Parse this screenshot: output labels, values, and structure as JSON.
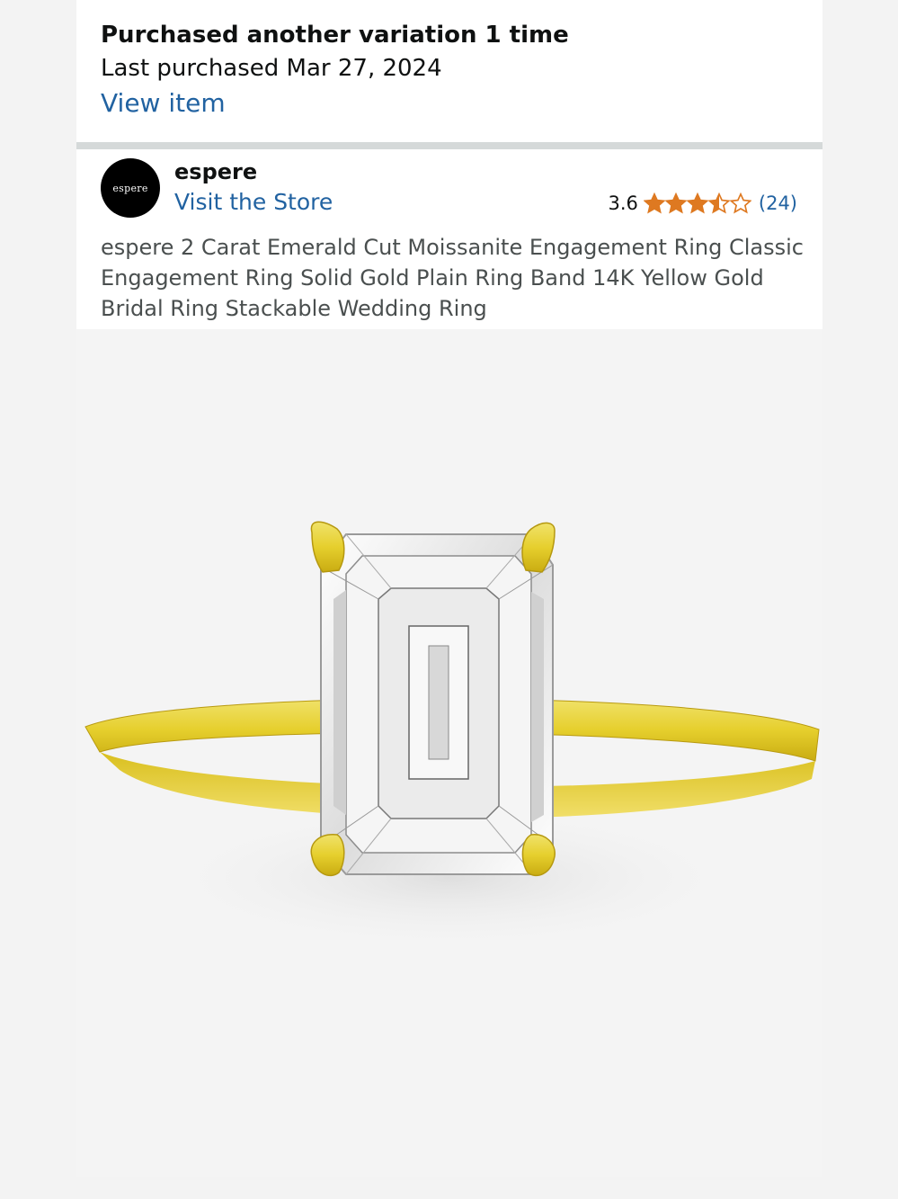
{
  "purchase_banner": {
    "title": "Purchased another variation 1 time",
    "last_purchased": "Last purchased Mar 27, 2024",
    "view_item_label": "View item"
  },
  "store": {
    "logo_text": "espere",
    "name": "espere",
    "visit_label": "Visit the Store",
    "rating_value": "3.6",
    "rating_stars": 3.6,
    "rating_count": "(24)",
    "star_color": "#de7921"
  },
  "product": {
    "title": "espere 2 Carat Emerald Cut Moissanite Engagement Ring Classic Engagement Ring Solid Gold Plain Ring Band 14K Yellow Gold Bridal Ring Stackable Wedding Ring"
  },
  "colors": {
    "link": "#2162a1",
    "gold": "#e3cc2c",
    "divider": "#d5d9d9"
  }
}
